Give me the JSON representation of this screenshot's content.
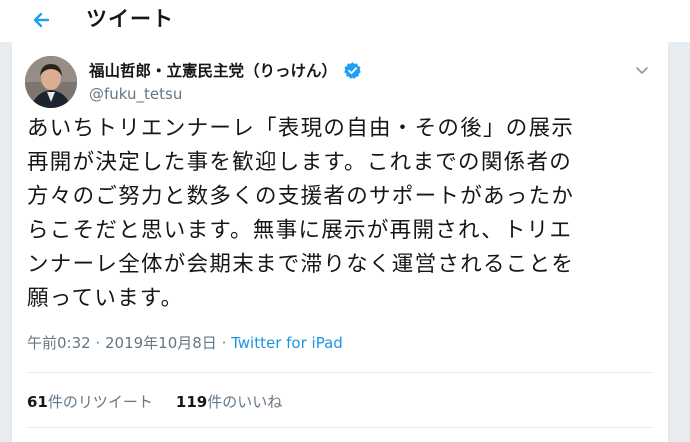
{
  "header": {
    "back_icon": "arrow-left-icon",
    "title": "ツイート"
  },
  "tweet": {
    "display_name": "福山哲郎・立憲民主党（りっけん）",
    "handle": "@fuku_tetsu",
    "verified_icon": "verified-badge-icon",
    "caret_icon": "chevron-down-icon",
    "text": "あいちトリエンナーレ「表現の自由・その後」の展示\n再開が決定した事を歓迎します。これまでの関係者の\n方々のご努力と数多くの支援者のサポートがあったか\nらこそだと思います。無事に展示が再開され、トリエ\nンナーレ全体が会期末まで滞りなく運営されることを\n願っています。",
    "timestamp": "午前0:32 · 2019年10月8日",
    "separator": " · ",
    "source": "Twitter for iPad"
  },
  "stats": {
    "retweets_count": "61",
    "retweets_label": "件のリツイート",
    "likes_count": "119",
    "likes_label": "件のいいね"
  },
  "colors": {
    "accent": "#1b95e0",
    "secondary_text": "#657786",
    "background": "#e6ecf0"
  }
}
